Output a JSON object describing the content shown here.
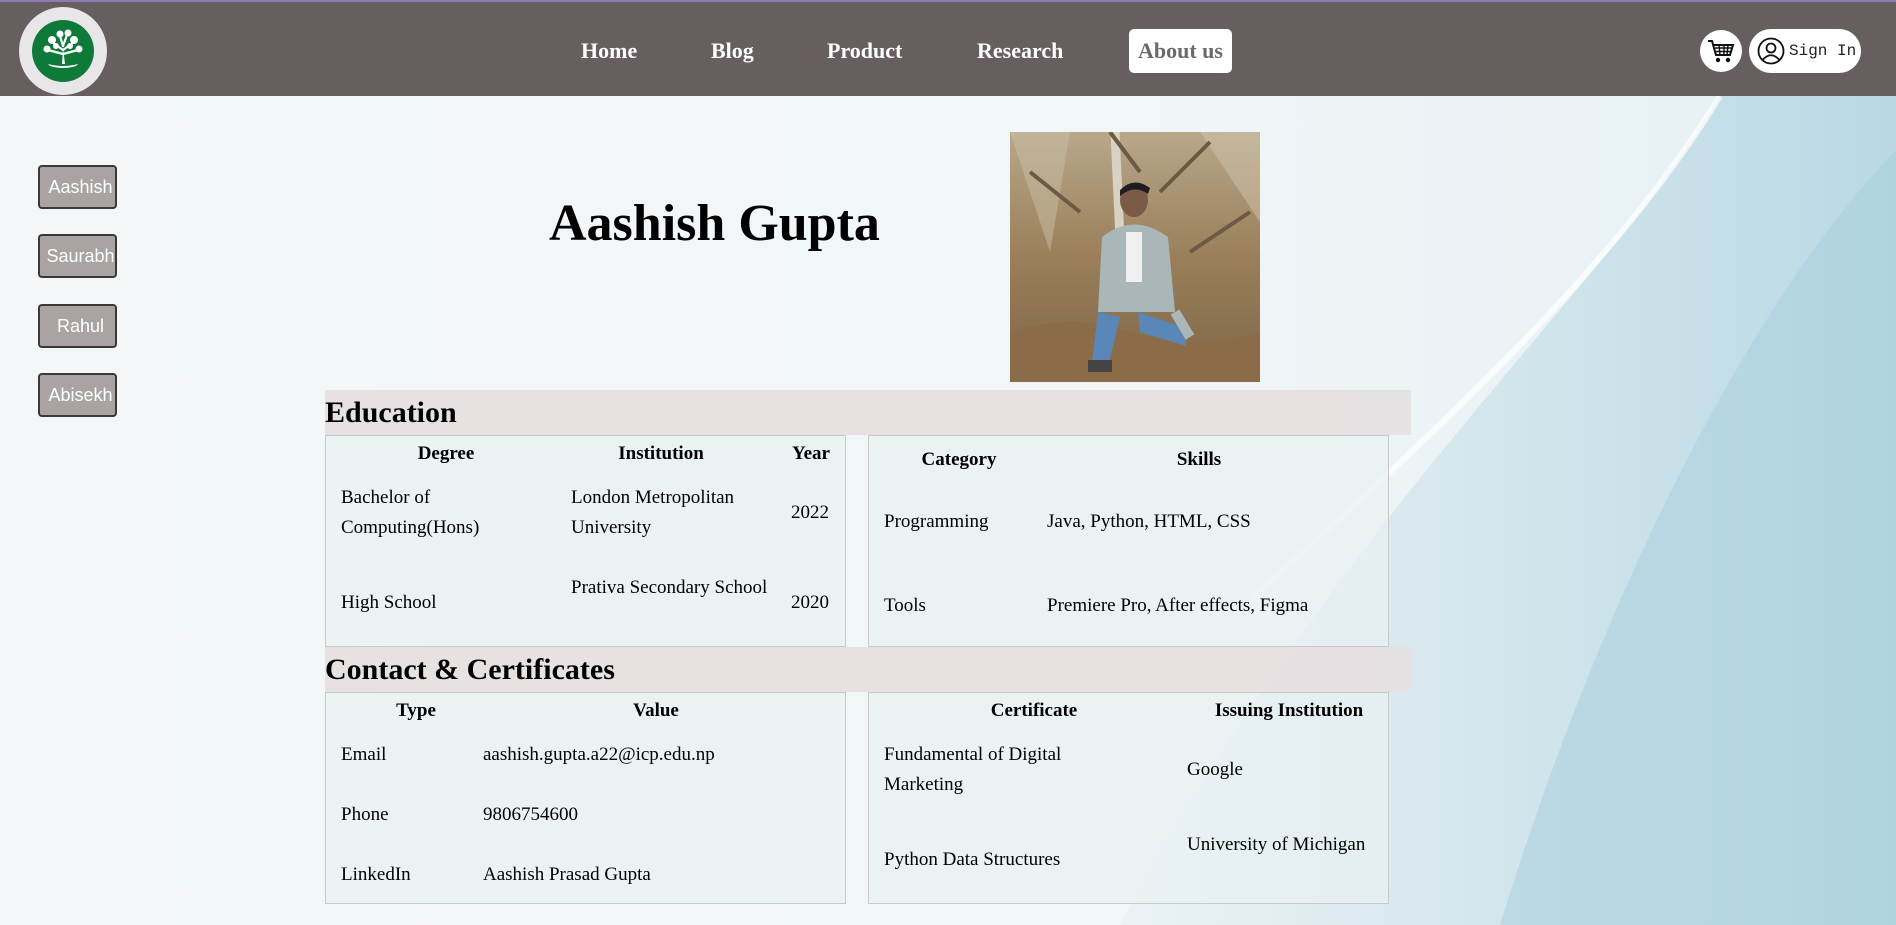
{
  "header": {
    "nav": [
      {
        "label": "Home",
        "active": false
      },
      {
        "label": "Blog",
        "active": false
      },
      {
        "label": "Product",
        "active": false
      },
      {
        "label": "Research",
        "active": false
      },
      {
        "label": "About us",
        "active": true
      }
    ],
    "signin_label": "Sign In",
    "cart_icon": "shopping-cart-icon",
    "user_icon": "user-circle-icon"
  },
  "sidebar": {
    "items": [
      {
        "label": "Aashish"
      },
      {
        "label": "Saurabh"
      },
      {
        "label": "Rahul"
      },
      {
        "label": "Abisekh"
      }
    ]
  },
  "profile": {
    "name": "Aashish Gupta"
  },
  "education": {
    "heading": "Education",
    "columns": [
      "Degree",
      "Institution",
      "Year"
    ],
    "rows": [
      {
        "degree": "Bachelor of Computing(Hons)",
        "institution": "London Metropolitan University",
        "year": "2022"
      },
      {
        "degree": "High School",
        "institution": "Prativa Secondary School",
        "year": "2020"
      }
    ]
  },
  "skills": {
    "columns": [
      "Category",
      "Skills"
    ],
    "rows": [
      {
        "category": "Programming",
        "skills": "Java, Python, HTML, CSS"
      },
      {
        "category": "Tools",
        "skills": "Premiere Pro, After effects, Figma"
      }
    ]
  },
  "contact": {
    "heading": "Contact & Certificates",
    "columns": [
      "Type",
      "Value"
    ],
    "rows": [
      {
        "type": "Email",
        "value": "aashish.gupta.a22@icp.edu.np"
      },
      {
        "type": "Phone",
        "value": "9806754600"
      },
      {
        "type": "LinkedIn",
        "value": "Aashish Prasad Gupta"
      }
    ]
  },
  "certificates": {
    "columns": [
      "Certificate",
      "Issuing Institution"
    ],
    "rows": [
      {
        "certificate": "Fundamental of Digital Marketing",
        "institution": "Google"
      },
      {
        "certificate": "Python Data Structures",
        "institution": "University of Michigan"
      }
    ]
  },
  "colors": {
    "header_bg": "#675e5f",
    "sidebar_button_bg": "#aaa3a3",
    "section_head_bg": "#e6dfe0",
    "logo_green": "#0e7a3a"
  }
}
